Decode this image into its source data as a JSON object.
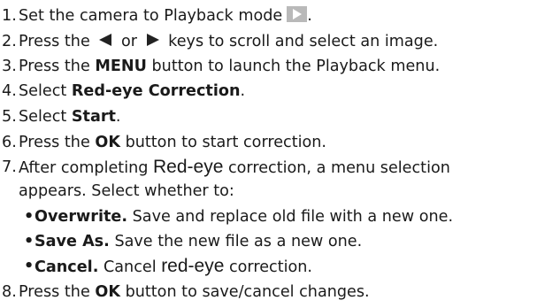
{
  "steps": [
    {
      "n": "1.",
      "text": "Set the camera to Playback mode",
      "tail": "."
    },
    {
      "n": "2.",
      "pre": "Press the",
      "mid": "or",
      "post": "keys to scroll and select an image."
    },
    {
      "n": "3.",
      "pre": "Press the",
      "bold": "MENU",
      "post": "button to launch the Playback menu."
    },
    {
      "n": "4.",
      "pre": "Select",
      "bold": "Red-eye Correction",
      "post": "."
    },
    {
      "n": "5.",
      "pre": "Select",
      "bold": "Start",
      "post": "."
    },
    {
      "n": "6.",
      "pre": "Press the",
      "bold": "OK",
      "post": "button to start correction."
    },
    {
      "n": "7.",
      "pre": "After completing",
      "big": "Red-eye",
      "post": "correction, a menu selection",
      "cont": "appears. Select whether to:"
    },
    {
      "n": "8.",
      "pre": "Press the",
      "bold": "OK",
      "post": "button to save/cancel changes."
    }
  ],
  "options": [
    {
      "bullet": "•",
      "bold": "Overwrite.",
      "text": "Save and replace old file with a new one."
    },
    {
      "bullet": "•",
      "bold": "Save As.",
      "text": "Save the new file as a new one."
    },
    {
      "bullet": "•",
      "bold": "Cancel.",
      "text": "Cancel",
      "big": "red-eye",
      "post": "correction."
    }
  ],
  "icons": {
    "playback": "playback-icon",
    "left": "left-arrow-icon",
    "right": "right-arrow-icon",
    "icon_box_color": "#b9b9b9",
    "arrow_color": "#222222"
  }
}
